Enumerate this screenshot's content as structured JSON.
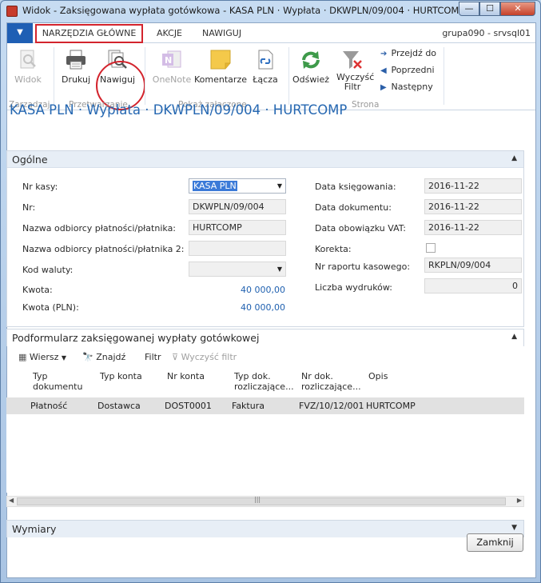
{
  "window": {
    "title": "Widok - Zaksięgowana wypłata gotówkowa - KASA PLN · Wypłata · DKWPLN/09/004 · HURTCOMP",
    "min": "—",
    "max": "☐",
    "close": "✕"
  },
  "tabs": {
    "home": "NARZĘDZIA GŁÓWNE",
    "actions": "AKCJE",
    "navigate": "NAWIGUJ"
  },
  "user": "grupa090 - srvsql01",
  "ribbon": {
    "view": "Widok",
    "print": "Drukuj",
    "navigate": "Nawiguj",
    "onenote": "OneNote",
    "comments": "Komentarze",
    "links": "Łącza",
    "refresh": "Odśwież",
    "clear_filter": "Wyczyść Filtr",
    "goto": "Przejdź do",
    "previous": "Poprzedni",
    "next": "Następny",
    "group_manage": "Zarządzaj",
    "group_process": "Przetwarzanie",
    "group_attachments": "Pokaż załączone",
    "group_page": "Strona"
  },
  "page_title": "KASA PLN · Wypłata · DKWPLN/09/004 · HURTCOMP",
  "general": {
    "header": "Ogólne",
    "nr_kasy_label": "Nr kasy:",
    "nr_kasy": "KASA PLN",
    "nr_label": "Nr:",
    "nr": "DKWPLN/09/004",
    "payee_label": "Nazwa odbiorcy płatności/płatnika:",
    "payee": "HURTCOMP",
    "payee2_label": "Nazwa odbiorcy płatności/płatnika 2:",
    "payee2": "",
    "currency_label": "Kod waluty:",
    "currency": "",
    "amount_label": "Kwota:",
    "amount": "40 000,00",
    "amount_pln_label": "Kwota (PLN):",
    "amount_pln": "40 000,00",
    "posting_date_label": "Data księgowania:",
    "posting_date": "2016-11-22",
    "doc_date_label": "Data dokumentu:",
    "doc_date": "2016-11-22",
    "vat_date_label": "Data obowiązku VAT:",
    "vat_date": "2016-11-22",
    "correction_label": "Korekta:",
    "correction": false,
    "report_label": "Nr raportu kasowego:",
    "report": "RKPLN/09/004",
    "prints_label": "Liczba wydruków:",
    "prints": "0"
  },
  "subform": {
    "header": "Podformularz zaksięgowanej wypłaty gotówkowej",
    "toolbar": {
      "line": "Wiersz",
      "find": "Znajdź",
      "filter": "Filtr",
      "clear_filter": "Wyczyść filtr"
    },
    "columns": [
      "Typ dokumentu",
      "Typ konta",
      "Nr konta",
      "Typ dok. rozliczające...",
      "Nr dok. rozliczające...",
      "Opis"
    ],
    "rows": [
      [
        "Płatność",
        "Dostawca",
        "DOST0001",
        "Faktura",
        "FVZ/10/12/001",
        "HURTCOMP"
      ]
    ],
    "scroll_grip": "|||"
  },
  "dimensions": {
    "header": "Wymiary"
  },
  "close_button": "Zamknij"
}
